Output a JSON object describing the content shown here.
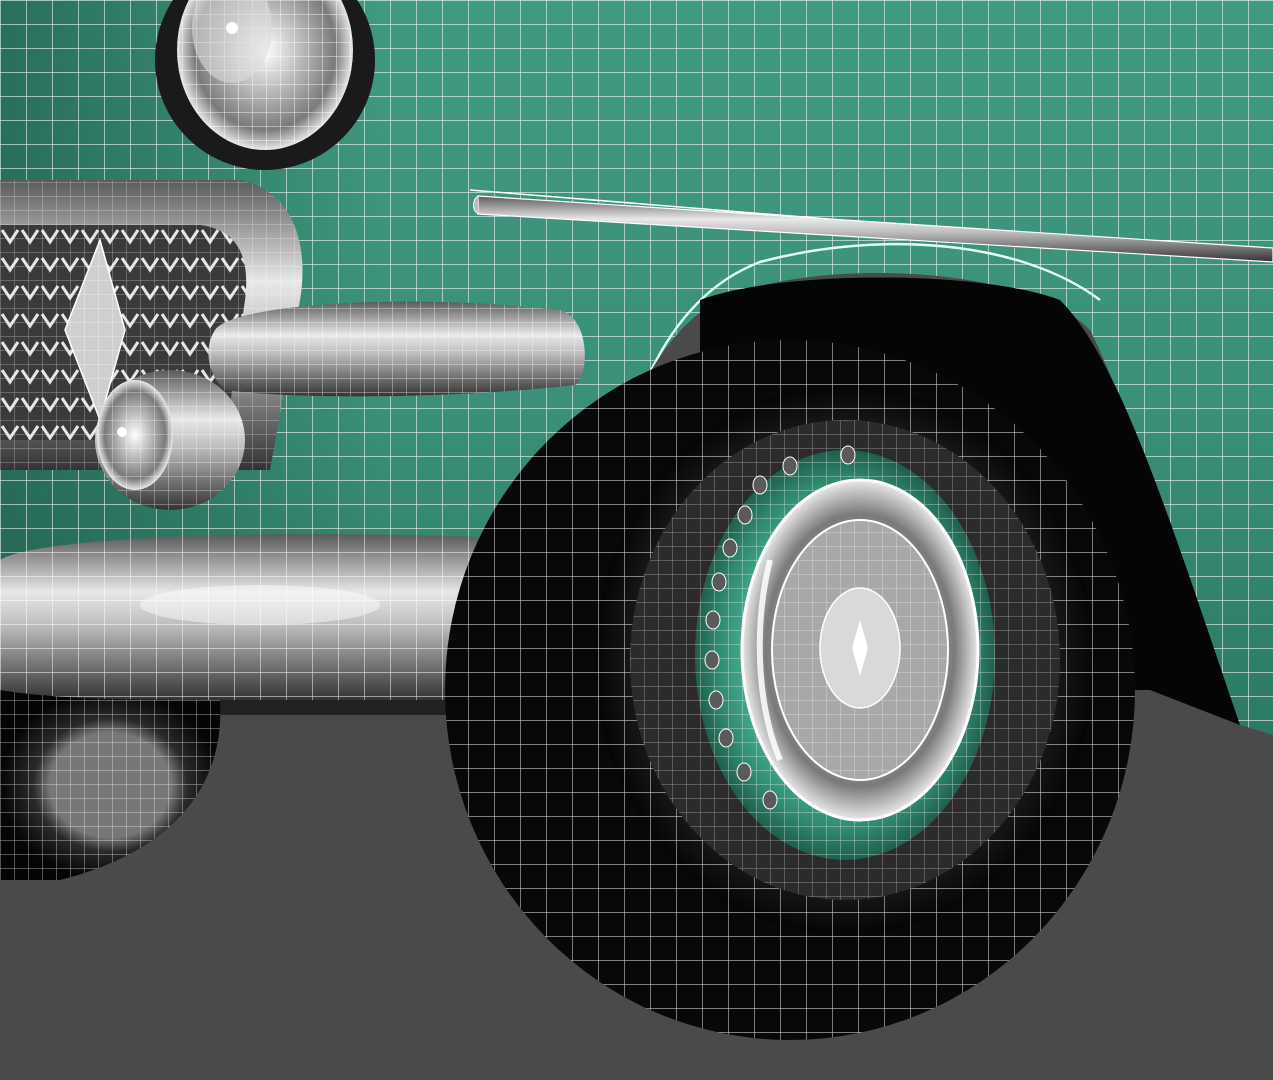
{
  "scene": {
    "subject_icon": "car-icon",
    "colors": {
      "background": "#4a4a4a",
      "body_paint": "#3f9a80",
      "body_paint_light": "#5cb89a",
      "body_paint_dark": "#1f5e4c",
      "chrome_light": "#f2f2f2",
      "chrome_mid": "#9a9a9a",
      "chrome_dark": "#3a3a3a",
      "tire": "#101010",
      "wireframe": "#ffffff"
    }
  }
}
